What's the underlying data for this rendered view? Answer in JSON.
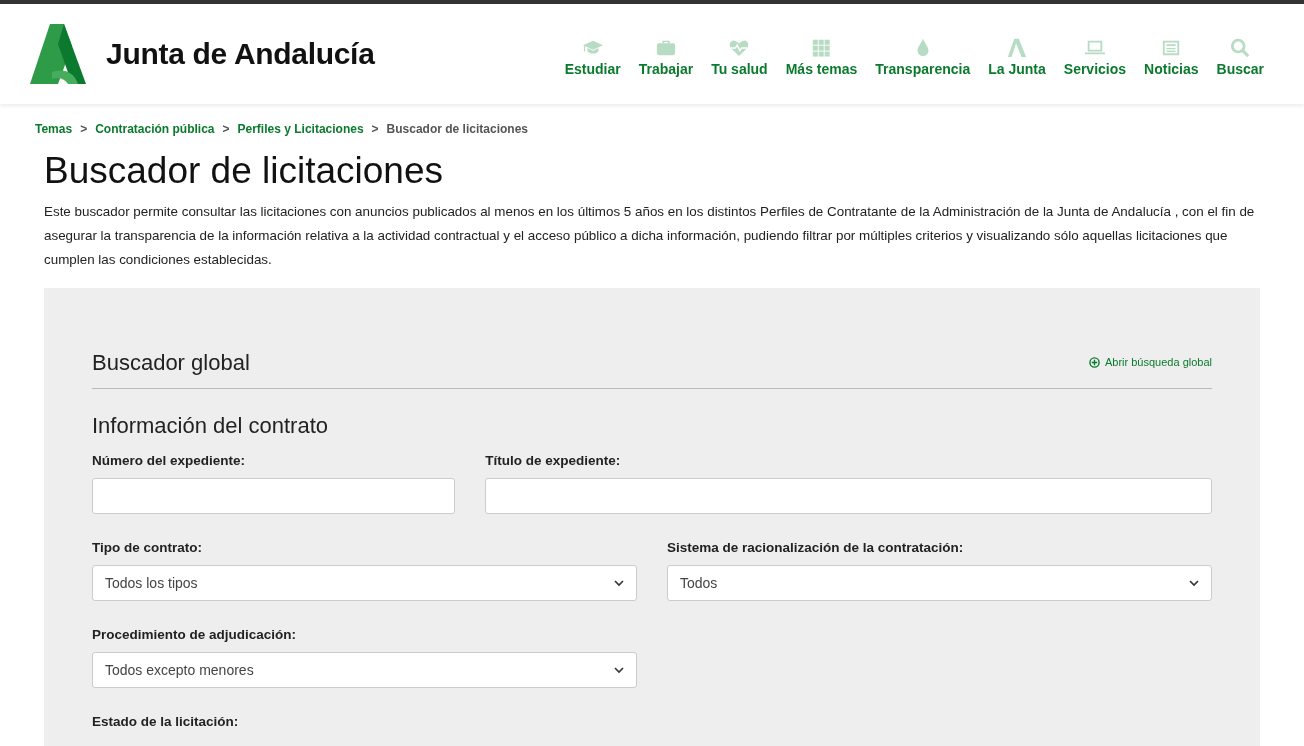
{
  "header": {
    "logo_text": "Junta de Andalucía",
    "nav": [
      {
        "label": "Estudiar",
        "kind": "cap"
      },
      {
        "label": "Trabajar",
        "kind": "briefcase"
      },
      {
        "label": "Tu salud",
        "kind": "heart"
      },
      {
        "label": "Más temas",
        "kind": "grid"
      },
      {
        "label": "Transparencia",
        "kind": "drop"
      },
      {
        "label": "La Junta",
        "kind": "logo"
      },
      {
        "label": "Servicios",
        "kind": "laptop"
      },
      {
        "label": "Noticias",
        "kind": "news"
      },
      {
        "label": "Buscar",
        "kind": "search"
      }
    ]
  },
  "breadcrumb": {
    "separator": ">",
    "items": [
      {
        "label": "Temas",
        "link": true
      },
      {
        "label": "Contratación pública",
        "link": true
      },
      {
        "label": "Perfiles y Licitaciones",
        "link": true
      },
      {
        "label": "Buscador de licitaciones",
        "link": false
      }
    ]
  },
  "page": {
    "title": "Buscador de licitaciones",
    "intro": "Este buscador permite consultar las licitaciones con anuncios publicados al menos en los últimos 5 años en los distintos Perfiles de Contratante de la Administración de la Junta de Andalucía , con el fin de asegurar la transparencia de la información relativa a la actividad contractual y el acceso público a dicha información, pudiendo filtrar por múltiples criterios y visualizando sólo aquellas licitaciones que cumplen las condiciones establecidas."
  },
  "search_panel": {
    "title": "Buscador global",
    "toggle_link": "Abrir búsqueda global",
    "section_title": "Información del contrato",
    "rows": [
      [
        {
          "label": "Número del expediente:",
          "kind": "text"
        },
        {
          "label": "Título de expediente:",
          "kind": "text"
        }
      ],
      [
        {
          "label": "Tipo de contrato:",
          "kind": "select",
          "value": "Todos los tipos"
        },
        {
          "label": "Sistema de racionalización de la contratación:",
          "kind": "select",
          "value": "Todos"
        }
      ],
      [
        {
          "label": "Procedimiento de adjudicación:",
          "kind": "select",
          "value": "Todos excepto menores"
        }
      ],
      [
        {
          "label": "Estado de la licitación:",
          "kind": "none"
        }
      ]
    ]
  }
}
